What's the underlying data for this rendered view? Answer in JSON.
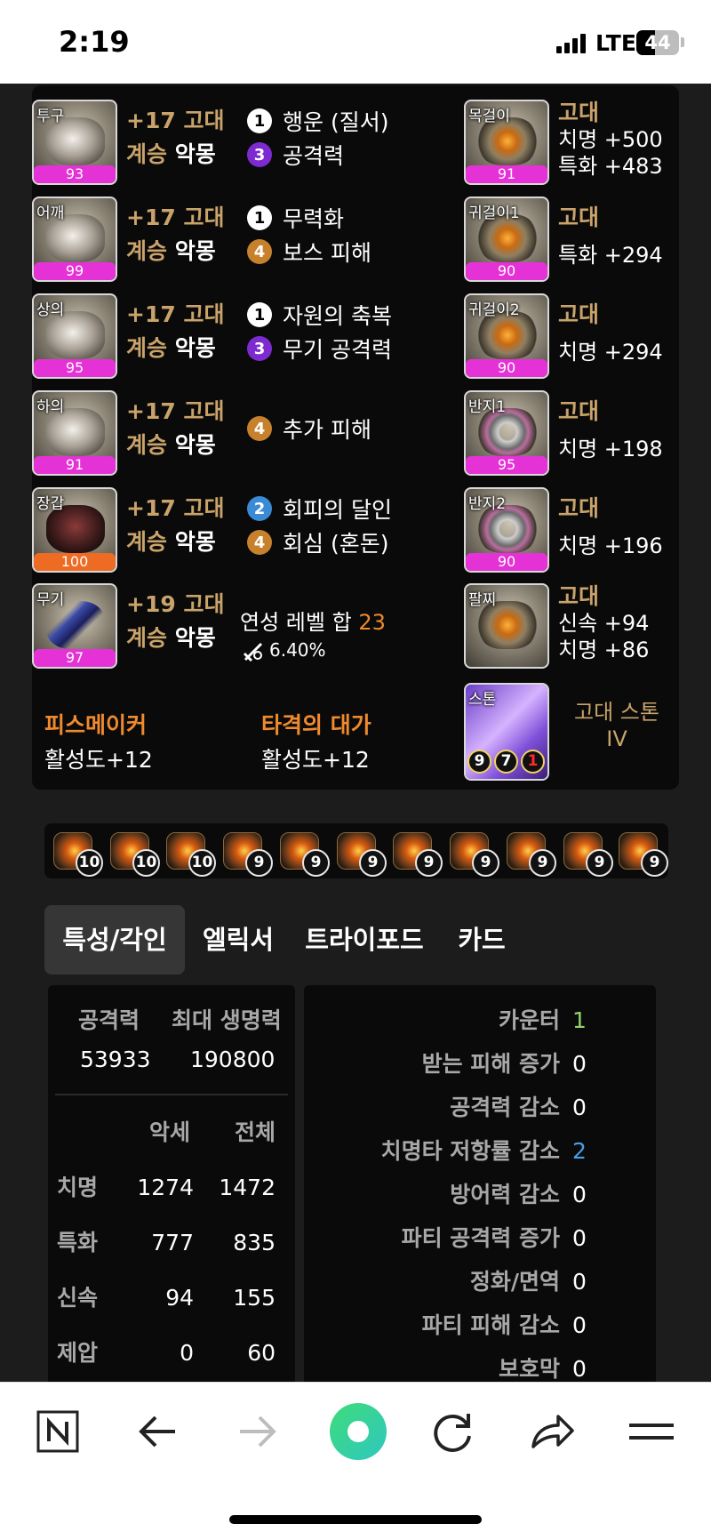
{
  "status": {
    "time": "2:19",
    "network": "LTE",
    "battery": "44"
  },
  "equipment": [
    {
      "slot": "투구",
      "quality": 93,
      "quality_color": "#e532d6",
      "enhance": "+17 고대",
      "set_prefix": "계승",
      "set_name": "악몽",
      "engravings": [
        {
          "level": "1",
          "name": "행운 (질서)",
          "color": "white"
        },
        {
          "level": "3",
          "name": "공격력",
          "color": "purple"
        }
      ]
    },
    {
      "slot": "어깨",
      "quality": 99,
      "quality_color": "#e532d6",
      "enhance": "+17 고대",
      "set_prefix": "계승",
      "set_name": "악몽",
      "engravings": [
        {
          "level": "1",
          "name": "무력화",
          "color": "white"
        },
        {
          "level": "4",
          "name": "보스 피해",
          "color": "orange"
        }
      ]
    },
    {
      "slot": "상의",
      "quality": 95,
      "quality_color": "#e532d6",
      "enhance": "+17 고대",
      "set_prefix": "계승",
      "set_name": "악몽",
      "engravings": [
        {
          "level": "1",
          "name": "자원의 축복",
          "color": "white"
        },
        {
          "level": "3",
          "name": "무기 공격력",
          "color": "purple"
        }
      ]
    },
    {
      "slot": "하의",
      "quality": 91,
      "quality_color": "#e532d6",
      "enhance": "+17 고대",
      "set_prefix": "계승",
      "set_name": "악몽",
      "engravings": [
        {
          "level": "4",
          "name": "추가 피해",
          "color": "orange"
        }
      ]
    },
    {
      "slot": "장갑",
      "quality": 100,
      "quality_color": "#ee6b24",
      "enhance": "+17 고대",
      "set_prefix": "계승",
      "set_name": "악몽",
      "engravings": [
        {
          "level": "2",
          "name": "회피의 달인",
          "color": "blue"
        },
        {
          "level": "4",
          "name": "회심 (혼돈)",
          "color": "orange"
        }
      ]
    },
    {
      "slot": "무기",
      "quality": 97,
      "quality_color": "#e532d6",
      "enhance": "+19 고대",
      "set_prefix": "계승",
      "set_name": "악몽"
    }
  ],
  "refine": {
    "label": "연성 레벨 합",
    "value": "23",
    "percent": "6.40%",
    "icon": "sword-icon"
  },
  "accessories": [
    {
      "slot": "목걸이",
      "quality": 91,
      "grade": "고대",
      "lines": [
        "치명 +500",
        "특화 +483"
      ]
    },
    {
      "slot": "귀걸이1",
      "quality": 90,
      "grade": "고대",
      "lines": [
        "특화 +294"
      ]
    },
    {
      "slot": "귀걸이2",
      "quality": 90,
      "grade": "고대",
      "lines": [
        "치명 +294"
      ]
    },
    {
      "slot": "반지1",
      "quality": 95,
      "grade": "고대",
      "lines": [
        "치명 +198"
      ]
    },
    {
      "slot": "반지2",
      "quality": 90,
      "grade": "고대",
      "lines": [
        "치명 +196"
      ]
    },
    {
      "slot": "팔찌",
      "grade": "고대",
      "lines": [
        "신속 +94",
        "치명 +86"
      ]
    }
  ],
  "stone": {
    "slot": "스톤",
    "name_line1": "고대 스톤",
    "name_line2": "IV",
    "values": [
      "9",
      "7",
      "1"
    ]
  },
  "bracelet_effects": [
    {
      "name": "피스메이커",
      "value": "활성도+12"
    },
    {
      "name": "타격의 대가",
      "value": "활성도+12"
    }
  ],
  "gems": [
    "10",
    "10",
    "10",
    "9",
    "9",
    "9",
    "9",
    "9",
    "9",
    "9",
    "9"
  ],
  "tabs": [
    "특성/각인",
    "엘릭서",
    "트라이포드",
    "카드"
  ],
  "stats": {
    "attack_label": "공격력",
    "attack_value": "53933",
    "hp_label": "최대 생명력",
    "hp_value": "190800",
    "col_acc": "악세",
    "col_total": "전체",
    "rows": [
      {
        "name": "치명",
        "acc": "1274",
        "total": "1472"
      },
      {
        "name": "특화",
        "acc": "777",
        "total": "835"
      },
      {
        "name": "신속",
        "acc": "94",
        "total": "155"
      },
      {
        "name": "제압",
        "acc": "0",
        "total": "60"
      }
    ]
  },
  "synergies": [
    {
      "name": "카운터",
      "value": "1",
      "color": "#8fd46a"
    },
    {
      "name": "받는 피해 증가",
      "value": "0",
      "color": "#ffffff"
    },
    {
      "name": "공격력 감소",
      "value": "0",
      "color": "#ffffff"
    },
    {
      "name": "치명타 저항률 감소",
      "value": "2",
      "color": "#4a9ee6"
    },
    {
      "name": "방어력 감소",
      "value": "0",
      "color": "#ffffff"
    },
    {
      "name": "파티 공격력 증가",
      "value": "0",
      "color": "#ffffff"
    },
    {
      "name": "정화/면역",
      "value": "0",
      "color": "#ffffff"
    },
    {
      "name": "파티 피해 감소",
      "value": "0",
      "color": "#ffffff"
    },
    {
      "name": "보호막",
      "value": "0",
      "color": "#ffffff"
    }
  ],
  "toolbar": {
    "icons": [
      "naver-home-icon",
      "back-arrow-icon",
      "forward-arrow-icon",
      "green-dot-icon",
      "reload-icon",
      "share-icon",
      "menu-icon"
    ]
  }
}
